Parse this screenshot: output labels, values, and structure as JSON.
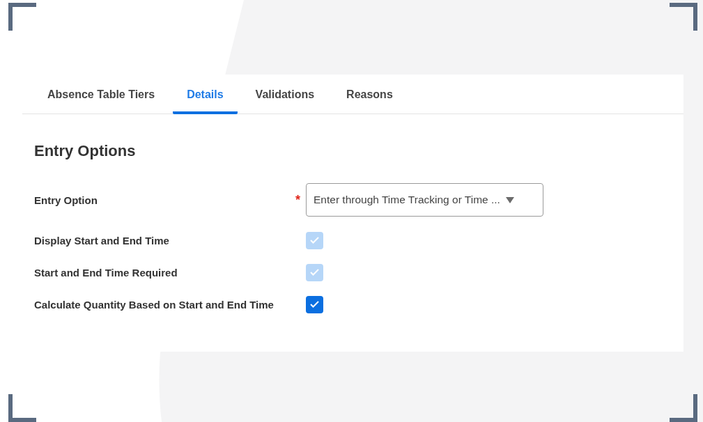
{
  "tabs": [
    {
      "label": "Absence Table Tiers",
      "selected": false
    },
    {
      "label": "Details",
      "selected": true
    },
    {
      "label": "Validations",
      "selected": false
    },
    {
      "label": "Reasons",
      "selected": false
    }
  ],
  "section": {
    "title": "Entry Options"
  },
  "fields": [
    {
      "kind": "select",
      "label": "Entry Option",
      "required_mark": "*",
      "value": "Enter through Time Tracking or Time ..."
    },
    {
      "kind": "checkbox",
      "label": "Display Start and End Time",
      "checked": true,
      "disabled": true
    },
    {
      "kind": "checkbox",
      "label": "Start and End Time Required",
      "checked": true,
      "disabled": true
    },
    {
      "kind": "checkbox",
      "label": "Calculate Quantity Based on Start and End Time",
      "checked": true,
      "disabled": false
    }
  ]
}
